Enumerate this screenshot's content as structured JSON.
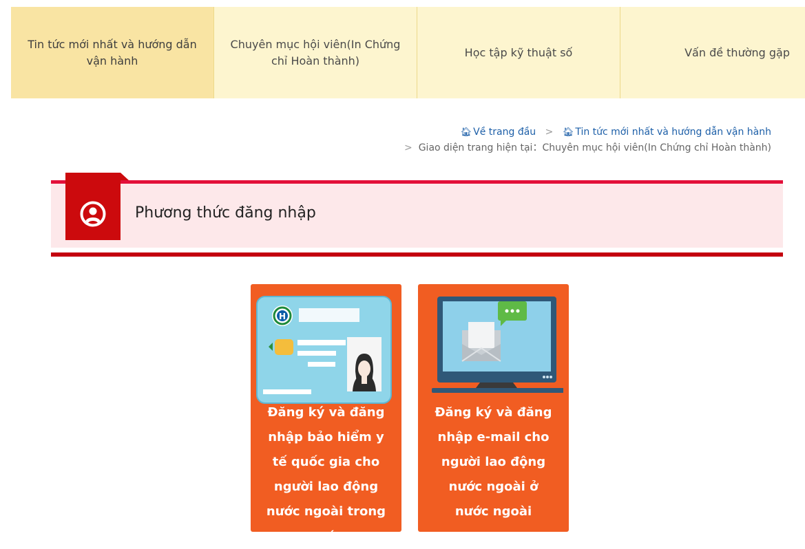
{
  "nav": {
    "items": [
      {
        "label": "Tin tức mới nhất và hướng dẫn vận hành"
      },
      {
        "label": "Chuyên mục hội viên(In Chứng chỉ Hoàn thành)"
      },
      {
        "label": "Học tập kỹ thuật số"
      },
      {
        "label": "Vấn đề thường gặp"
      }
    ]
  },
  "breadcrumb": {
    "home": "Về trang đầu",
    "separator": ">",
    "news": "Tin tức mới nhất và hướng dẫn vận hành",
    "current_prefix": "Giao diện trang hiện tại：",
    "current": "Chuyên mục hội viên(In Chứng chỉ Hoàn thành)"
  },
  "section": {
    "title": "Phương thức đăng nhập"
  },
  "cards": [
    {
      "label": "Đăng ký và đăng nhập bảo hiểm y tế quốc gia cho người lao động nước ngoài trong nước"
    },
    {
      "label": "Đăng ký và đăng nhập e-mail cho người lao động nước ngoài ở nước ngoài"
    }
  ],
  "colors": {
    "nav_bg": "#fdf5cf",
    "nav_active": "#f9e4a3",
    "accent_red": "#e3103a",
    "dark_red": "#c4000f",
    "card_orange": "#f15d22",
    "header_pink": "#fde8ea"
  },
  "icons": {
    "breadcrumb": "home-icon",
    "section": "user-circle-icon",
    "card_1": "health-insurance-card-icon",
    "card_2": "computer-email-icon"
  }
}
